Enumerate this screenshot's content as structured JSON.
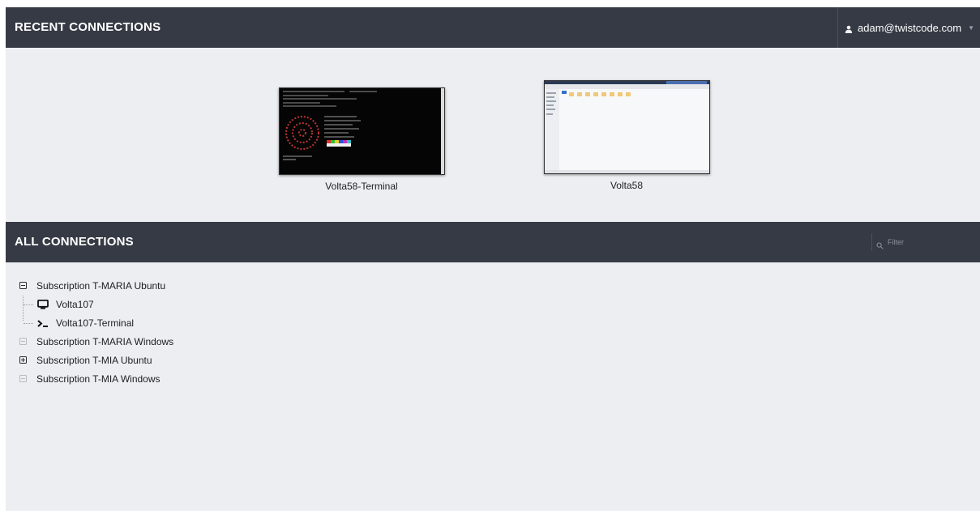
{
  "recent": {
    "title": "RECENT CONNECTIONS",
    "user": "adam@twistcode.com",
    "connections": [
      {
        "name": "Volta58-Terminal",
        "kind": "terminal"
      },
      {
        "name": "Volta58",
        "kind": "desktop"
      }
    ]
  },
  "all": {
    "title": "ALL CONNECTIONS",
    "filter_placeholder": "Filter",
    "groups": [
      {
        "label": "Subscription T-MARIA Ubuntu",
        "state": "expanded",
        "children": [
          {
            "label": "Volta107",
            "icon": "desktop-icon"
          },
          {
            "label": "Volta107-Terminal",
            "icon": "terminal-icon"
          }
        ]
      },
      {
        "label": "Subscription T-MARIA Windows",
        "state": "empty"
      },
      {
        "label": "Subscription T-MIA Ubuntu",
        "state": "collapsed"
      },
      {
        "label": "Subscription T-MIA Windows",
        "state": "empty"
      }
    ]
  }
}
